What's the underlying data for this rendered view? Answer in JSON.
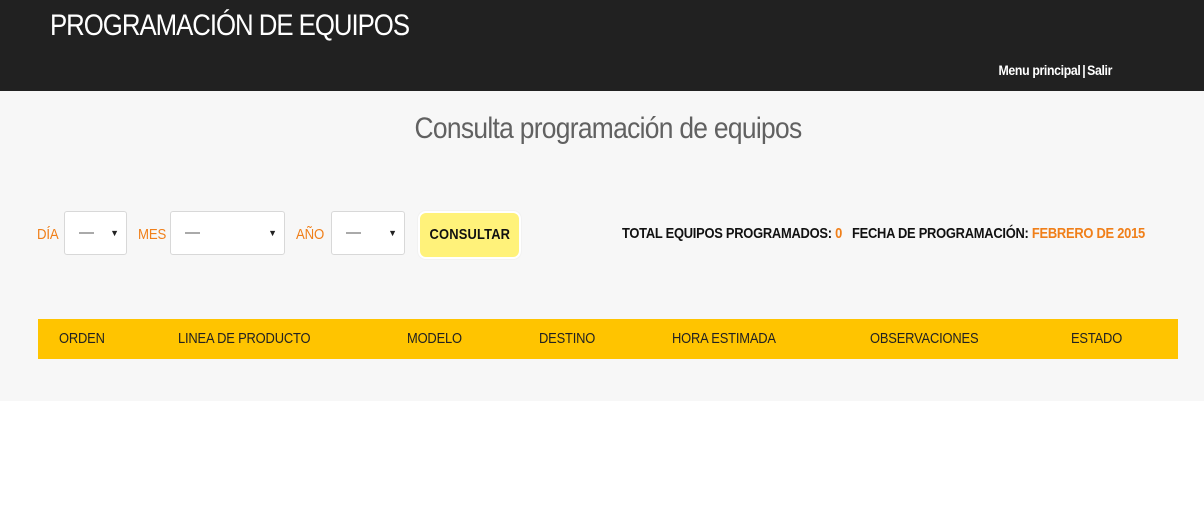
{
  "header": {
    "app_title": "PROGRAMACIÓN DE EQUIPOS",
    "nav": {
      "menu_principal": "Menu principal",
      "separator": "|",
      "salir": "Salir"
    }
  },
  "main": {
    "page_title": "Consulta programación de equipos",
    "filters": {
      "dia_label": "DÍA",
      "dia_value": "—",
      "mes_label": "MES",
      "mes_value": "—",
      "anio_label": "AÑO",
      "anio_value": "—",
      "consultar_label": "CONSULTAR"
    },
    "summary": {
      "total_label": "TOTAL EQUIPOS PROGRAMADOS:",
      "total_value": "0",
      "fecha_label": "FECHA DE PROGRAMACIÓN:",
      "fecha_value": "FEBRERO DE 2015"
    },
    "table": {
      "columns": [
        "ORDEN",
        "LINEA DE PRODUCTO",
        "MODELO",
        "DESTINO",
        "HORA ESTIMADA",
        "OBSERVACIONES",
        "ESTADO"
      ],
      "rows": []
    }
  },
  "colors": {
    "topbar": "#212121",
    "accent_orange": "#f07f19",
    "table_header": "#ffc400",
    "button": "#fff27a"
  }
}
